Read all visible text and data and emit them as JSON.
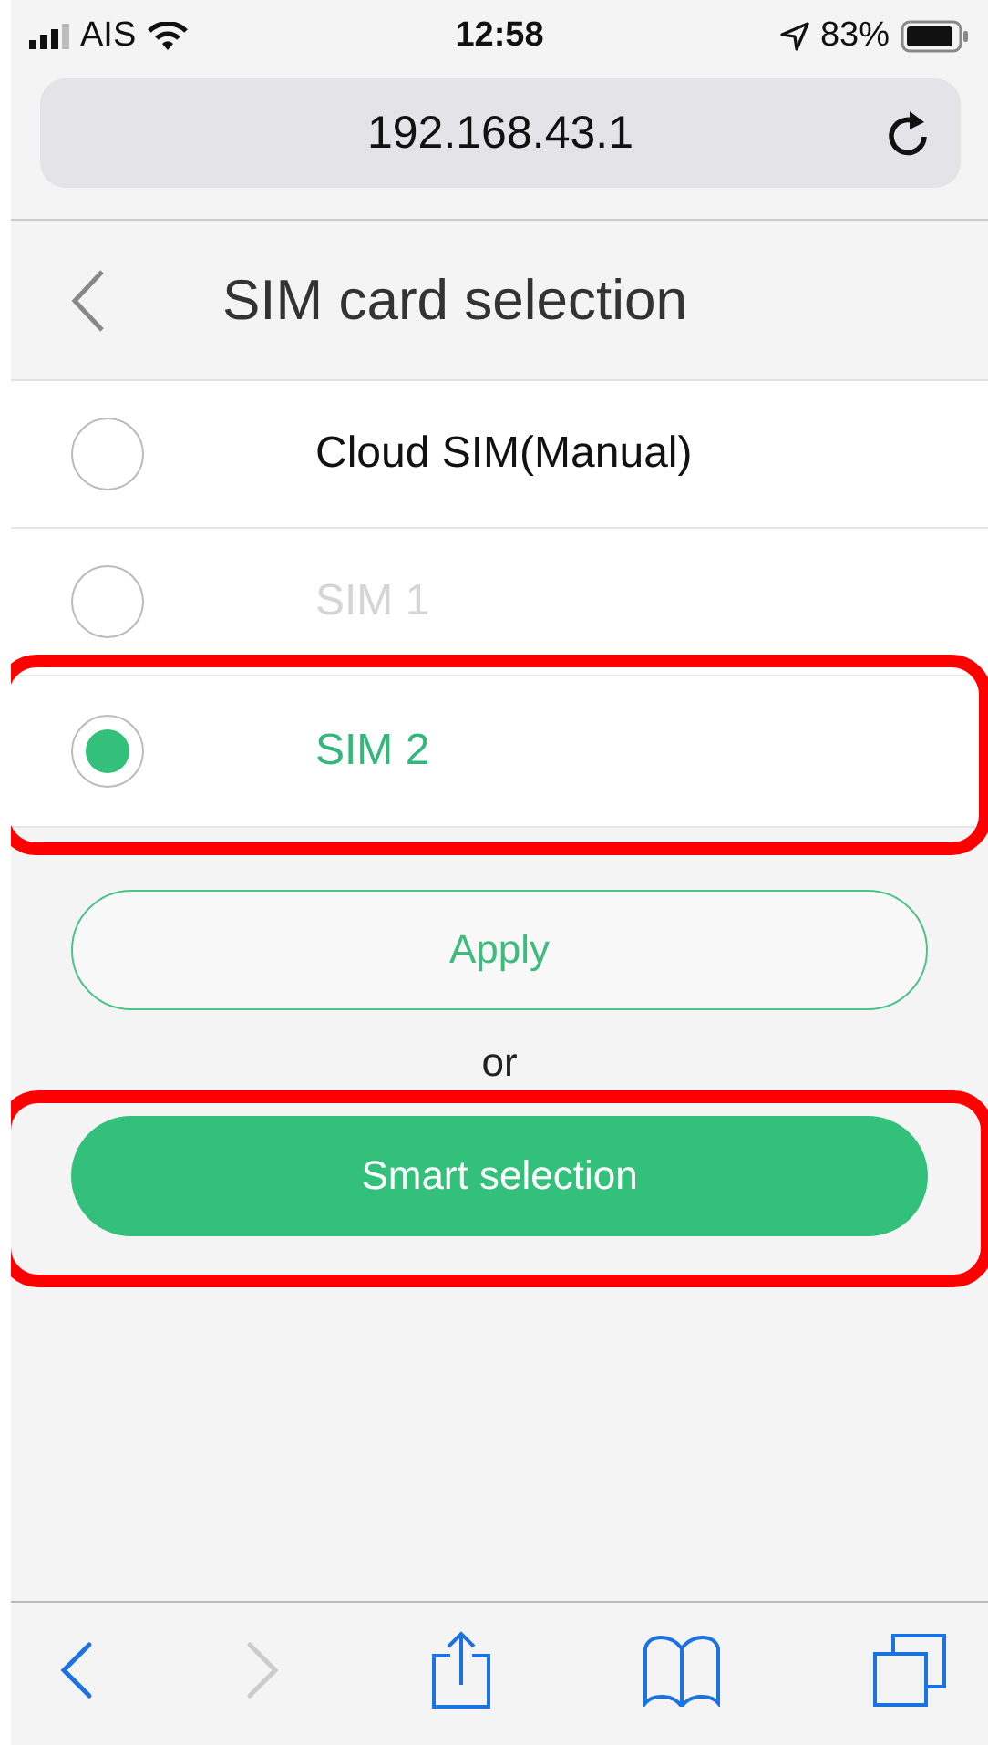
{
  "status_bar": {
    "carrier": "AIS",
    "time": "12:58",
    "battery": "83%"
  },
  "address_bar": {
    "url": "192.168.43.1"
  },
  "header": {
    "title": "SIM card selection"
  },
  "options": [
    {
      "label": "Cloud SIM(Manual)",
      "selected": false,
      "disabled": false,
      "highlighted": false
    },
    {
      "label": "SIM 1",
      "selected": false,
      "disabled": true,
      "highlighted": false
    },
    {
      "label": "SIM 2",
      "selected": true,
      "disabled": false,
      "highlighted": true
    }
  ],
  "apply_button": {
    "label": "Apply"
  },
  "separator": "or",
  "smart_button": {
    "label": "Smart selection",
    "highlighted": true
  },
  "toolbar": [
    {
      "kind": "back",
      "disabled": false
    },
    {
      "kind": "forward",
      "disabled": true
    },
    {
      "kind": "share",
      "disabled": false
    },
    {
      "kind": "bookmarks",
      "disabled": false
    },
    {
      "kind": "tabs",
      "disabled": false
    }
  ]
}
